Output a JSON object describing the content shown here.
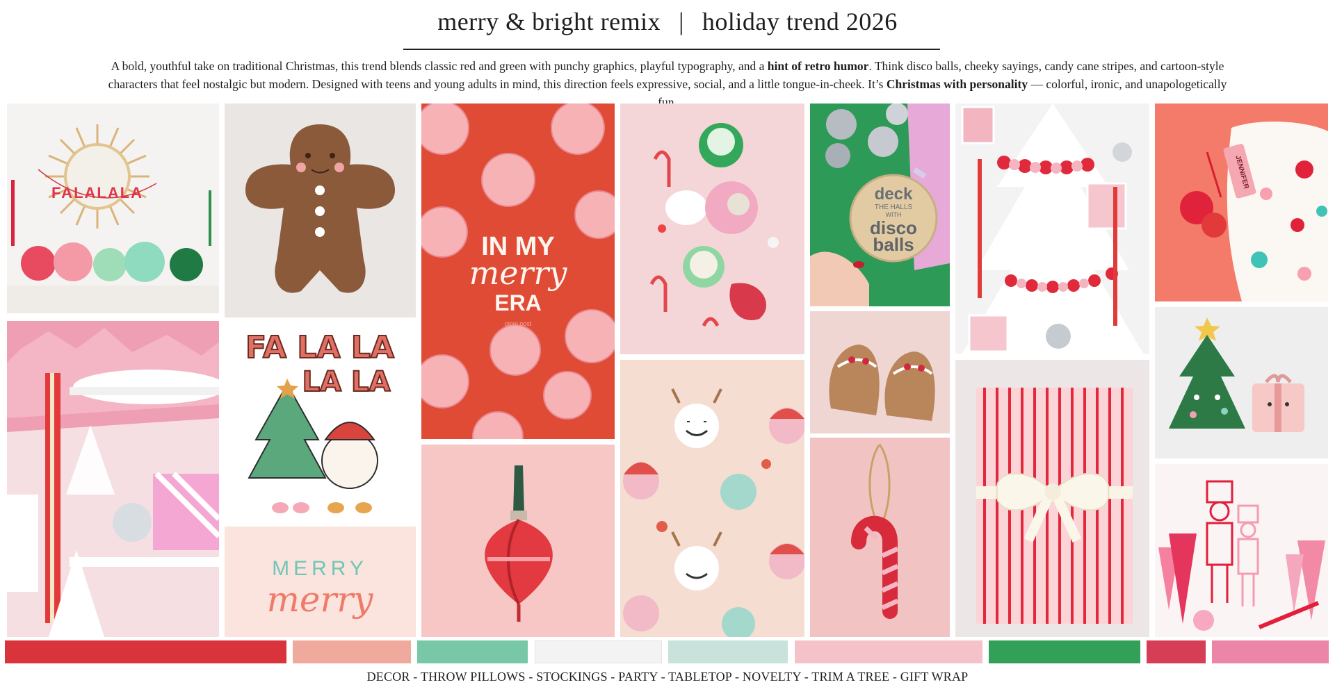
{
  "header": {
    "title_left": "merry & bright remix",
    "separator": "|",
    "title_right": "holiday trend 2026"
  },
  "description": {
    "part1": "A bold, youthful take on traditional Christmas, this trend blends classic red and green with punchy graphics, playful typography, and a ",
    "bold1": "hint of retro humor",
    "part2": ". Think disco balls, cheeky sayings, candy cane stripes, and cartoon-style characters that feel nostalgic but modern. Designed with teens and young adults in mind, this direction feels expressive, social, and a little tongue-in-cheek. It’s ",
    "bold2": "Christmas with personality",
    "part3": " — colorful, ironic, and unapologetically fun."
  },
  "tiles": {
    "falala_garland": "FALALALA",
    "fa_la_la_line1": "FA LA LA",
    "fa_la_la_line2": "LA LA",
    "merry_line1": "MERRY",
    "merry_line2": "merry",
    "merry_era_line1": "IN MY",
    "merry_era_line2": "merry",
    "merry_era_line3": "ERA",
    "merry_era_credit": "pippi post",
    "deck_line1": "deck",
    "deck_line2": "THE HALLS",
    "deck_line3": "WITH",
    "deck_line4": "disco",
    "deck_line5": "balls",
    "stocking_tag": "JENNIFER"
  },
  "palette": [
    "#d9333b",
    "#f0a99d",
    "#78c8a8",
    "#f3f3f3",
    "#c9e2db",
    "#f6c2c9",
    "#33a05a",
    "#d63d56",
    "#eb86a8"
  ],
  "categories": "DECOR - THROW PILLOWS - STOCKINGS - PARTY - TABLETOP - NOVELTY - TRIM A TREE - GIFT WRAP"
}
